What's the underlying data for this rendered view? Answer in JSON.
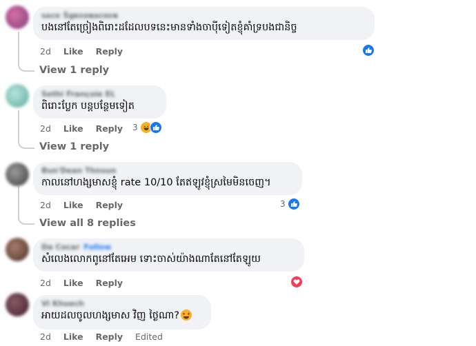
{
  "colors": {
    "like": "#1877f2",
    "love": "#f33e58",
    "bubble": "#f0f2f5",
    "secondary_text": "#65676b"
  },
  "comments": [
    {
      "author": "sᴀᴄк Ŝɡʀᴇᴏɴᴀсʜᴇɴ",
      "text": "បងនៅតែច្រៀងពិរោះដដែលបទនេះមានទាំងចាប៉ីទៀតខ្ញុំគាំទ្របងជានិច្ច",
      "time": "2d",
      "like_label": "Like",
      "reply_label": "Reply",
      "reactions": {
        "count": "",
        "icons": [
          "like-icon"
        ]
      },
      "view_replies": "View 1 reply"
    },
    {
      "author": "Sethi Françoie EL",
      "text": "ពិរោះប្លែក បន្ដបន្ថែមទៀត",
      "time": "2d",
      "like_label": "Like",
      "reply_label": "Reply",
      "reactions": {
        "count": "3",
        "icons": [
          "haha-icon",
          "like-icon"
        ]
      },
      "view_replies": "View 1 reply"
    },
    {
      "author": "Bun'Dean Thnsun",
      "text": "កាលនៅហង្សមាសខ្ញុំ rate 10/10 តែឥឡូវខ្ញុំស្រមៃមិនចេញ។",
      "time": "2d",
      "like_label": "Like",
      "reply_label": "Reply",
      "reactions": {
        "count": "3",
        "icons": [
          "like-icon"
        ]
      },
      "view_replies": "View all 8 replies"
    },
    {
      "author": "Da Cocar",
      "follow_label": "Follow",
      "text": "សំលេងលោកពូនៅតែអេម ទោះចាស់យ៉ាងណាតែនៅតែឡូយ",
      "time": "2d",
      "like_label": "Like",
      "reply_label": "Reply",
      "reactions": {
        "count": "",
        "icons": [
          "love-icon"
        ]
      }
    },
    {
      "author": "Vi Khuech",
      "text": "អាយដលចូលហង្សមាស វិញ ថ្ងៃណា?",
      "time": "2d",
      "like_label": "Like",
      "reply_label": "Reply",
      "edited_label": "Edited"
    }
  ]
}
